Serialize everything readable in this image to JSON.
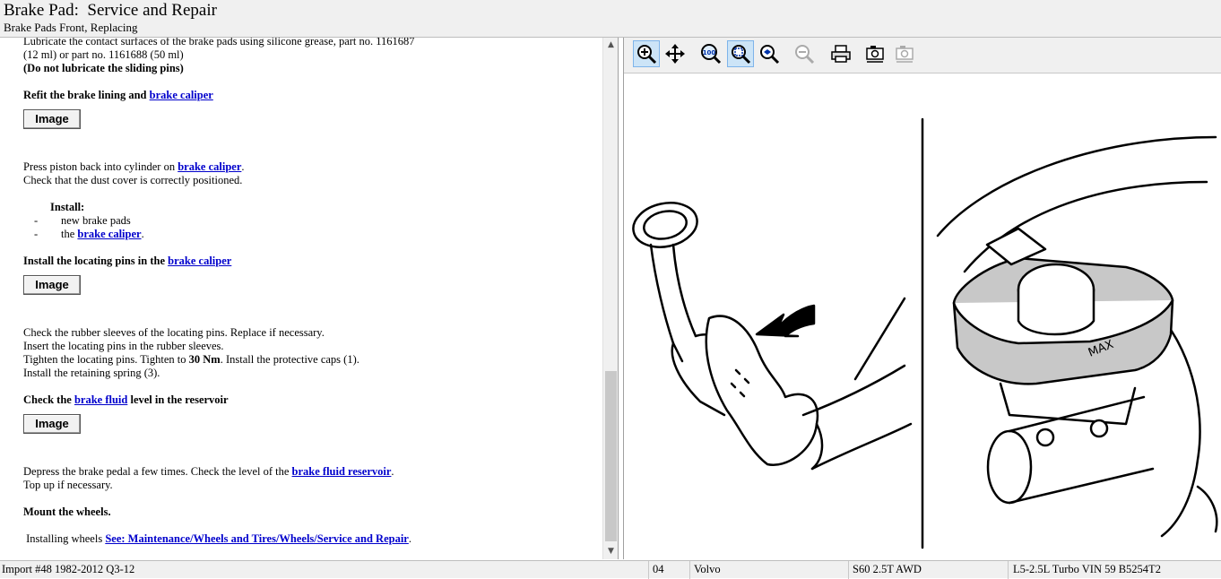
{
  "header": {
    "title": "Brake Pad:  Service and Repair",
    "subtitle": "Brake Pads Front, Replacing"
  },
  "doc": {
    "lube_line1": "Lubricate the contact surfaces of the brake pads using silicone grease, part no. 1161687",
    "lube_line2": "(12 ml) or part no. 1161688 (50 ml)",
    "lube_note": "(Do not lubricate the sliding pins)",
    "refit_text": "Refit the brake lining and ",
    "refit_link": "brake caliper",
    "image_button": "Image",
    "press_text": "Press piston back into cylinder on ",
    "press_link": "brake caliper",
    "press_end": ".",
    "dust_cover": "Check that the dust cover is correctly positioned.",
    "install_heading": "Install:",
    "install_dash": "-",
    "install_item1": "new brake pads",
    "install_item2_pre": "the ",
    "install_item2_link": "brake caliper",
    "install_item2_end": ".",
    "locating_text": "Install the locating pins in the ",
    "locating_link": "brake caliper",
    "sleeves": "Check the rubber sleeves of the locating pins. Replace if necessary.",
    "insert": "Insert the locating pins in the rubber sleeves.",
    "tighten_pre": "Tighten the locating pins. Tighten to ",
    "tighten_torque": "30 Nm",
    "tighten_post": ". Install the protective caps (1).",
    "spring": "Install the retaining spring (3).",
    "fluid_pre": "Check the ",
    "fluid_link": "brake fluid",
    "fluid_post": " level in the reservoir",
    "depress_pre": "Depress the brake pedal a few times. Check the level of the ",
    "depress_link": "brake fluid reservoir",
    "depress_end": ".",
    "topup": "Top up if necessary.",
    "mount": "Mount the wheels.",
    "wheels_pre": " Installing wheels ",
    "wheels_link": "See: Maintenance/Wheels and Tires/Wheels/Service and Repair",
    "wheels_end": "."
  },
  "scrollbar": {
    "up_arrow": "▲",
    "down_arrow": "▼"
  },
  "toolbar": {
    "icons": [
      "zoom-in-icon",
      "pan-icon",
      "zoom-100-icon",
      "zoom-fit-icon",
      "zoom-area-icon",
      "zoom-out-icon",
      "print-icon",
      "copy-image-icon",
      "save-image-icon"
    ]
  },
  "illustration": {
    "label": "MAX"
  },
  "status": {
    "source": "Import #48 1982-2012 Q3-12",
    "section": "04",
    "make": "Volvo",
    "model": "S60 2.5T AWD",
    "engine": "L5-2.5L Turbo VIN 59 B5254T2"
  },
  "colors": {
    "link": "#0000cc",
    "toolbar_active": "#cce4f7",
    "reservoir_fill": "#c8c8c8"
  }
}
